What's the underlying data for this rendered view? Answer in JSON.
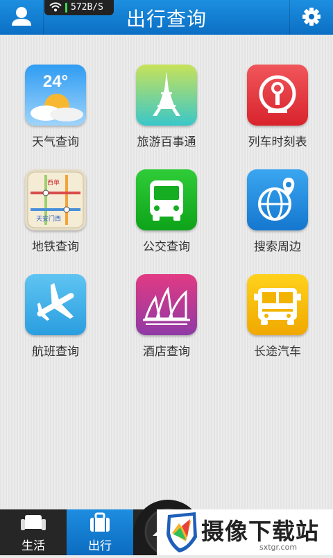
{
  "header": {
    "title": "出行查询",
    "speed": "572B/S",
    "left_icon": "user-icon",
    "right_icon": "gear-icon"
  },
  "grid": [
    {
      "label": "天气查询",
      "icon": "weather-icon",
      "icon_text": "24°"
    },
    {
      "label": "旅游百事通",
      "icon": "eiffel-tower-icon"
    },
    {
      "label": "列车时刻表",
      "icon": "railway-icon"
    },
    {
      "label": "地铁查询",
      "icon": "subway-map-icon",
      "icon_text_top": "西单",
      "icon_text_bottom": "天安门西"
    },
    {
      "label": "公交查询",
      "icon": "bus-icon"
    },
    {
      "label": "搜索周边",
      "icon": "globe-pin-icon"
    },
    {
      "label": "航班查询",
      "icon": "airplane-icon"
    },
    {
      "label": "酒店查询",
      "icon": "hotel-icon"
    },
    {
      "label": "长途汽车",
      "icon": "coach-icon"
    }
  ],
  "nav": {
    "items": [
      {
        "label": "生活",
        "icon": "sofa-icon"
      },
      {
        "label": "出行",
        "icon": "briefcase-icon"
      }
    ],
    "active": "出行"
  },
  "watermark": {
    "title": "摄像下载站",
    "url": "sxtgr.com"
  },
  "colors": {
    "header": "#1482d8",
    "nav_bg": "#262626",
    "nav_active": "#137ad2"
  }
}
